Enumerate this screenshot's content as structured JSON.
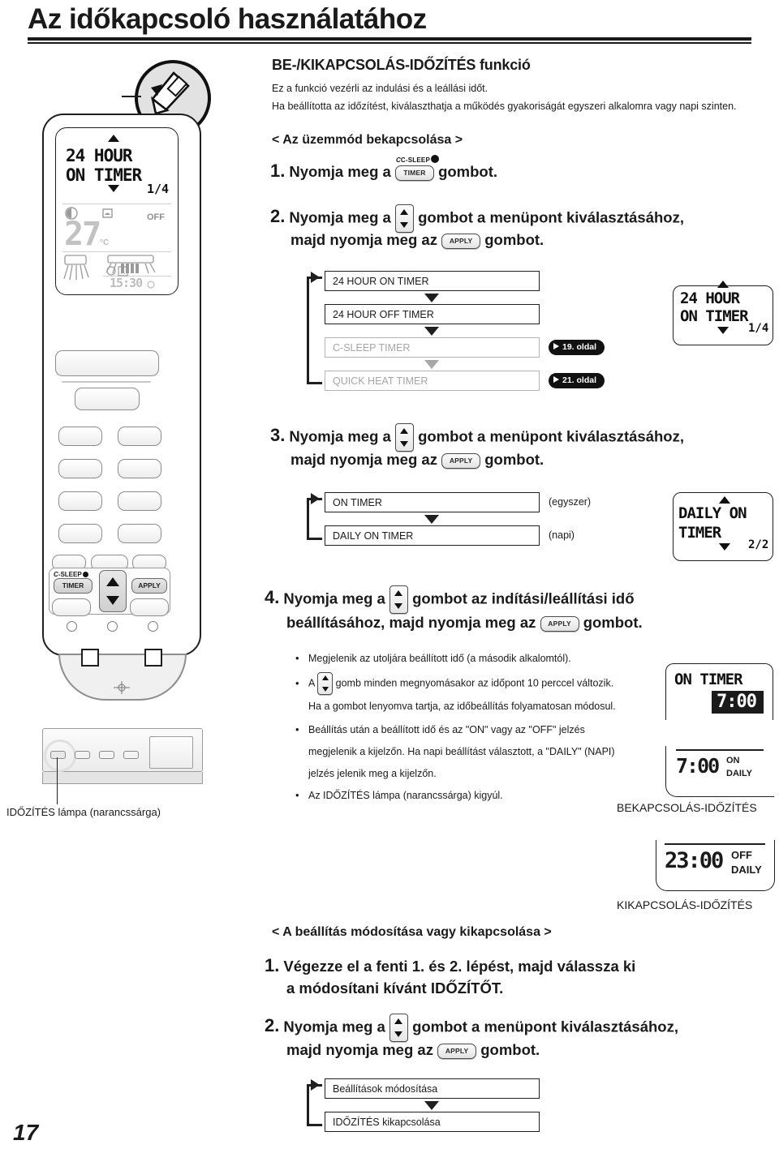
{
  "page": {
    "title": "Az időkapcsoló használatához",
    "number": "17"
  },
  "section": {
    "heading": "BE-/KIKAPCSOLÁS-IDŐZÍTÉS funkció",
    "intro_line1": "Ez a funkció vezérli az indulási és a leállási időt.",
    "intro_line2": "Ha beállította az időzítést, kiválaszthatja a működés gyakoriságát egyszeri alkalomra vagy napi szinten.",
    "subhead_start": "< Az üzemmód bekapcsolása >",
    "subhead_modify": "< A beállítás módosítása vagy kikapcsolása >"
  },
  "steps": {
    "s1": {
      "num": "1.",
      "a": "Nyomja meg a",
      "b": "gombot."
    },
    "s2": {
      "num": "2.",
      "a": "Nyomja meg a",
      "b": "gombot a menüpont kiválasztásához,",
      "c": "majd nyomja meg az",
      "d": "gombot."
    },
    "s3": {
      "num": "3.",
      "a": "Nyomja meg a",
      "b": "gombot a menüpont kiválasztásához,",
      "c": "majd nyomja meg az",
      "d": "gombot."
    },
    "s4": {
      "num": "4.",
      "a": "Nyomja meg a",
      "b": "gombot az indítási/leállítási idő",
      "c": "beállításához, majd nyomja meg az",
      "d": "gombot."
    },
    "m1": {
      "num": "1.",
      "a": "Végezze el a fenti 1. és 2. lépést, majd válassza ki",
      "b": "a módosítani kívánt IDŐZÍTŐT."
    },
    "m2": {
      "num": "2.",
      "a": "Nyomja meg a",
      "b": "gombot a menüpont kiválasztásához,",
      "c": "majd nyomja meg az",
      "d": "gombot."
    }
  },
  "keys": {
    "timer_label": "TIMER",
    "csleep_label": "C-SLEEP",
    "apply_label": "APPLY"
  },
  "flow1": {
    "items": [
      {
        "label": "24 HOUR ON TIMER",
        "dim": false,
        "page_ref": ""
      },
      {
        "label": "24 HOUR OFF TIMER",
        "dim": false,
        "page_ref": ""
      },
      {
        "label": "C-SLEEP TIMER",
        "dim": true,
        "page_ref": "19. oldal"
      },
      {
        "label": "QUICK HEAT TIMER",
        "dim": true,
        "page_ref": "21. oldal"
      }
    ]
  },
  "flow2": {
    "items": [
      {
        "label": "ON TIMER",
        "note": "(egyszer)"
      },
      {
        "label": "DAILY ON TIMER",
        "note": "(napi)"
      }
    ]
  },
  "flow3": {
    "items": [
      {
        "label": "Beállítások módosítása"
      },
      {
        "label": "IDŐZÍTÉS kikapcsolása"
      }
    ]
  },
  "notes": [
    "Megjelenik az utoljára beállított idő (a második alkalomtól).",
    "gomb minden megnyomásakor az időpont 10 perccel változik.",
    "Ha a gombot lenyomva tartja, az időbeállítás folyamatosan módosul.",
    "Beállítás után a beállított idő és az \"ON\" vagy az \"OFF\" jelzés",
    "megjelenik a kijelzőn. Ha napi beállítást választott, a \"DAILY\" (NAPI)",
    "jelzés jelenik meg a kijelzőn.",
    "Az IDŐZÍTÉS lámpa (narancssárga) kigyúl."
  ],
  "note_prefix_a": "A",
  "lcd_remote": {
    "line1": "24 HOUR",
    "line2": "ON TIMER",
    "page_indicator": "1/4",
    "temp": "27",
    "temp_unit": "°C",
    "off_mark": "OFF",
    "clock": "15:30"
  },
  "lcd_step2": {
    "line1": "24 HOUR",
    "line2": "ON TIMER",
    "page_indicator": "1/4"
  },
  "lcd_step3": {
    "line1": "DAILY ON",
    "line2": "TIMER",
    "page_indicator": "2/2"
  },
  "lcd_on_timer": {
    "title": "ON TIMER",
    "value": "7:00"
  },
  "lcd_on_daily": {
    "value": "7:00",
    "mark1": "ON",
    "mark2": "DAILY"
  },
  "lcd_off_daily": {
    "value": "23:00",
    "mark1": "OFF",
    "mark2": "DAILY"
  },
  "captions": {
    "timer_lamp": "IDŐZÍTÉS lámpa (narancssárga)",
    "on_timer_caption": "BEKAPCSOLÁS-IDŐZÍTÉS",
    "off_timer_caption": "KIKAPCSOLÁS-IDŐZÍTÉS"
  },
  "colors": {
    "ink": "#1a1a1a",
    "dim": "#a6a6a6",
    "pill_bg": "#111111"
  }
}
